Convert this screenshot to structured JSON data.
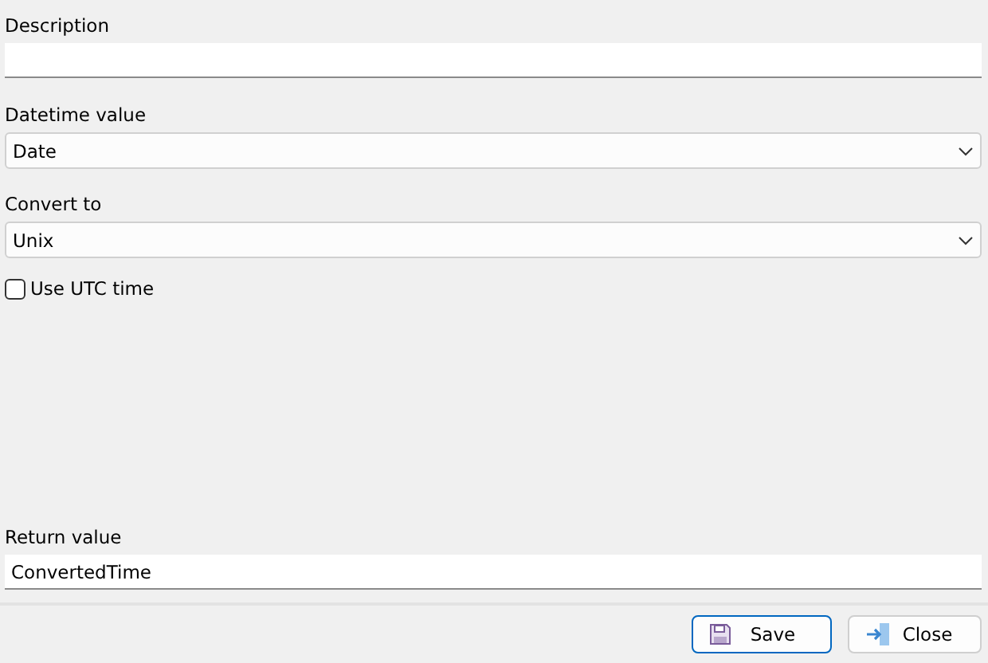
{
  "fields": [
    {
      "kind": "text",
      "label": "Description"
    },
    {
      "kind": "select",
      "label": "Datetime value",
      "value": "Date"
    },
    {
      "kind": "select",
      "label": "Convert to",
      "value": "Unix"
    }
  ],
  "utc": {
    "label": "Use UTC time",
    "checked": false
  },
  "return_value": {
    "label": "Return value",
    "value": "ConvertedTime"
  },
  "buttons": [
    {
      "kind": "save",
      "label": "Save",
      "default": true
    },
    {
      "kind": "close",
      "label": "Close",
      "default": false
    }
  ]
}
